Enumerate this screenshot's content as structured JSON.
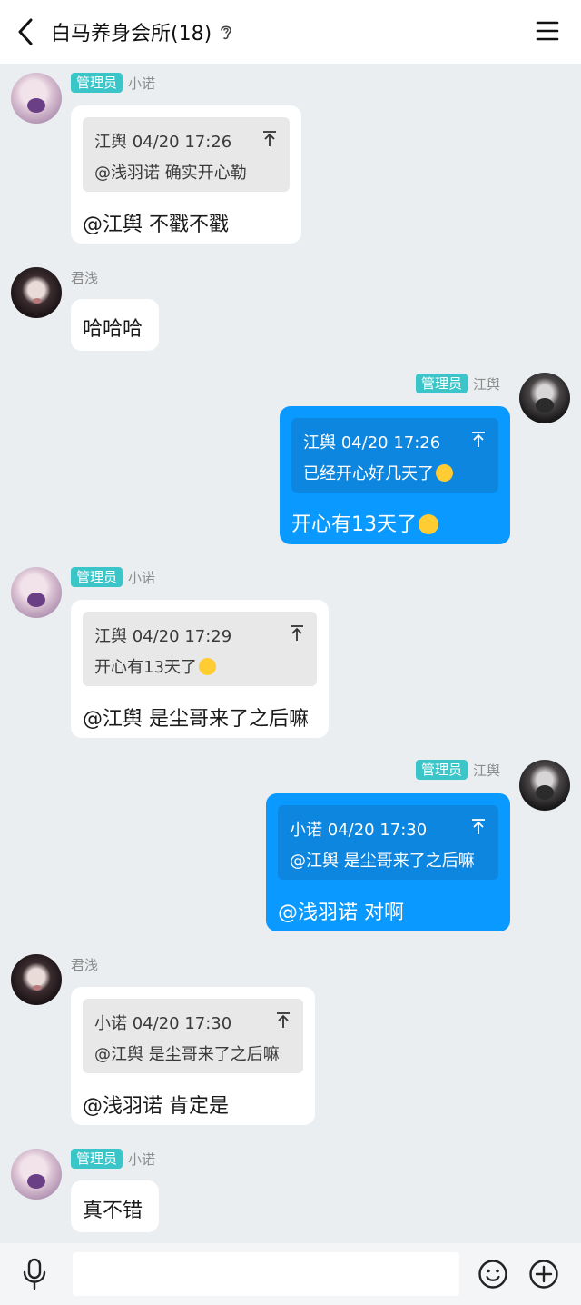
{
  "header": {
    "back_icon": "chevron-left-icon",
    "title": "白马养身会所(18)",
    "ear_icon": "ear-icon",
    "menu_icon": "menu-icon"
  },
  "messages": [
    {
      "sender": "小诺",
      "badge": "管理员",
      "side": "left",
      "quote": {
        "head": "江舆 04/20 17:26",
        "text": "@浅羽诺 确实开心勒"
      },
      "text": "@江舆 不戳不戳"
    },
    {
      "sender": "君浅",
      "badge": "",
      "side": "left",
      "text": "哈哈哈"
    },
    {
      "sender": "江舆",
      "badge": "管理员",
      "side": "right",
      "quote": {
        "head": "江舆 04/20 17:26",
        "text": "已经开心好几天了"
      },
      "text": "开心有13天了"
    },
    {
      "sender": "小诺",
      "badge": "管理员",
      "side": "left",
      "quote": {
        "head": "江舆 04/20 17:29",
        "text": "开心有13天了"
      },
      "text": "@江舆 是尘哥来了之后嘛"
    },
    {
      "sender": "江舆",
      "badge": "管理员",
      "side": "right",
      "quote": {
        "head": "小诺 04/20 17:30",
        "text": "@江舆 是尘哥来了之后嘛"
      },
      "text": "@浅羽诺 对啊"
    },
    {
      "sender": "君浅",
      "badge": "",
      "side": "left",
      "quote": {
        "head": "小诺 04/20 17:30",
        "text": "@江舆 是尘哥来了之后嘛"
      },
      "text": "@浅羽诺 肯定是"
    },
    {
      "sender": "小诺",
      "badge": "管理员",
      "side": "left",
      "text": "真不错"
    }
  ],
  "input_bar": {
    "mic_icon": "microphone-icon",
    "input_value": "",
    "emoji_icon": "smiley-icon",
    "plus_icon": "plus-circle-icon"
  },
  "colors": {
    "background": "#eaeef0",
    "my_bubble": "#0a99ff",
    "badge": "#3cc5c8"
  }
}
